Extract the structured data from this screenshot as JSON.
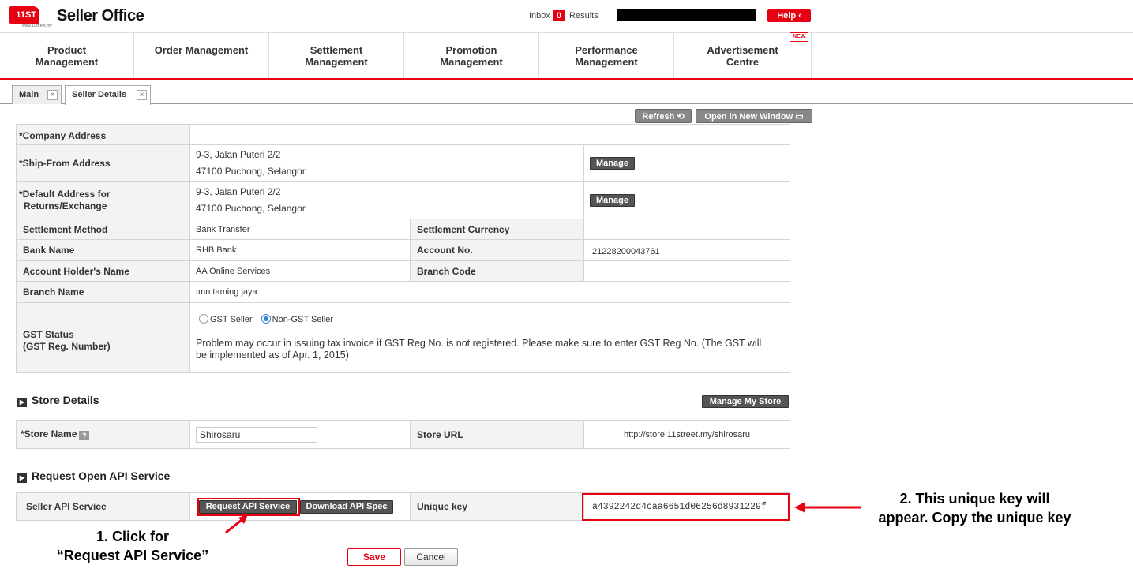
{
  "header": {
    "logo_text": "11ST",
    "logo_sub": "www.11street.my",
    "app_title": "Seller Office",
    "inbox_label": "Inbox",
    "inbox_count": "0",
    "results_label": "Results",
    "help_label": "Help"
  },
  "nav": {
    "items": [
      {
        "label": "Product\nManagement"
      },
      {
        "label": "Order Management"
      },
      {
        "label": "Settlement\nManagement"
      },
      {
        "label": "Promotion\nManagement"
      },
      {
        "label": "Performance\nManagement"
      },
      {
        "label": "Advertisement\nCentre"
      }
    ],
    "new_badge": "NEW"
  },
  "tabs": [
    {
      "label": "Main",
      "close": "×"
    },
    {
      "label": "Seller Details",
      "close": "×"
    }
  ],
  "toolbar": {
    "refresh_label": "Refresh ⟲",
    "open_new_window_label": "Open in New Window ▭"
  },
  "seller": {
    "company_address_label": "*Company Address",
    "ship_from_label": "*Ship-From Address",
    "ship_from_line1": "9-3, Jalan Puteri 2/2",
    "ship_from_line2": "47100 Puchong, Selangor",
    "return_label_1": "*Default Address for",
    "return_label_2": "Returns/Exchange",
    "return_line1": "9-3, Jalan Puteri 2/2",
    "return_line2": "47100 Puchong, Selangor",
    "manage_label": "Manage",
    "settlement_method_label": "Settlement Method",
    "settlement_method_value": "Bank Transfer",
    "settlement_currency_label": "Settlement Currency",
    "settlement_currency_value": "",
    "bank_name_label": "Bank Name",
    "bank_name_value": "RHB Bank",
    "account_no_label": "Account No.",
    "account_no_value": "21228200043761",
    "holder_label": "Account Holder's Name",
    "holder_value": "AA Online Services",
    "branch_code_label": "Branch Code",
    "branch_code_value": "",
    "branch_name_label": "Branch Name",
    "branch_name_value": "tmn taming jaya",
    "gst_label_1": "GST Status",
    "gst_label_2": "(GST Reg. Number)",
    "gst_option_1": "GST Seller",
    "gst_option_2": "Non-GST Seller",
    "gst_selected": "Non-GST Seller",
    "gst_note": "Problem may occur in issuing tax invoice if GST Reg No. is not registered. Please make sure to enter GST Reg No. (The GST will be implemented as of Apr. 1, 2015)"
  },
  "store": {
    "section_title": "Store Details",
    "manage_store_label": "Manage My Store",
    "store_name_label": "*Store Name",
    "store_name_help": "?",
    "store_name_value": "Shirosaru",
    "store_url_label": "Store URL",
    "store_url_value": "http://store.11street.my/shirosaru"
  },
  "api": {
    "section_title": "Request Open API Service",
    "service_label": "Seller API Service",
    "request_button": "Request API Service",
    "download_button": "Download API Spec",
    "unique_key_label": "Unique key",
    "unique_key_value": "a4392242d4caa6651d06256d8931229f"
  },
  "annotations": {
    "step1_line1": "1. Click for",
    "step1_line2": "“Request API Service”",
    "step2_line1": "2. This unique key will",
    "step2_line2": "appear. Copy the unique key"
  },
  "footer": {
    "save_label": "Save",
    "cancel_label": "Cancel"
  },
  "colors": {
    "brand_red": "#e60012",
    "button_dark": "#555555",
    "radio_blue": "#3a84d8"
  }
}
